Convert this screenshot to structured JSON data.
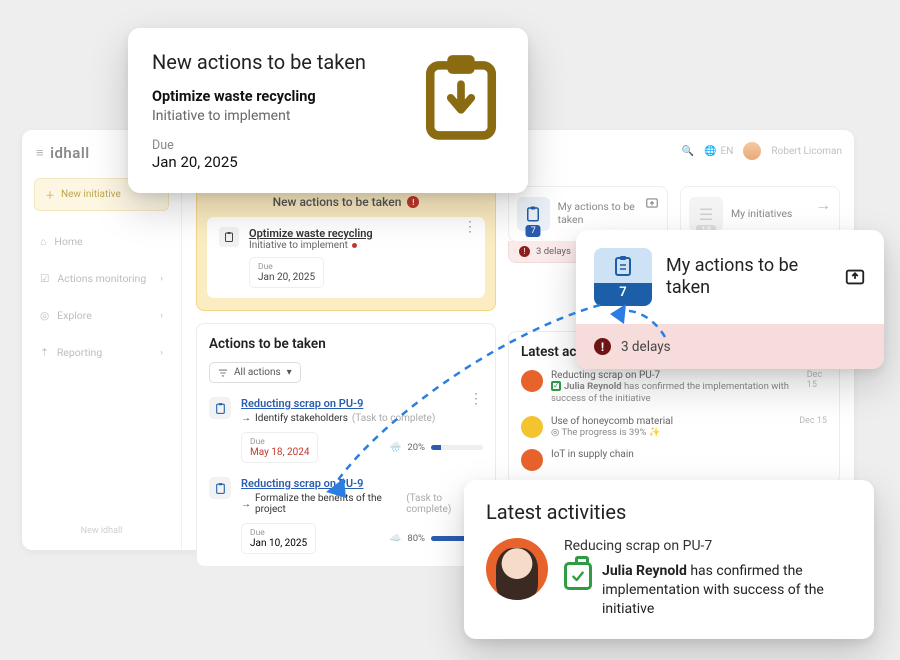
{
  "brand": "idhall",
  "topbar": {
    "lang": "EN",
    "user": "Robert Licoman"
  },
  "sidebar": {
    "new_initiative": "New initiative",
    "items": [
      {
        "label": "Home"
      },
      {
        "label": "Actions monitoring"
      },
      {
        "label": "Explore"
      },
      {
        "label": "Reporting"
      }
    ],
    "footer": "New idhall"
  },
  "highlight": {
    "title": "New actions to be taken",
    "item": {
      "title": "Optimize waste recycling",
      "subtitle": "Initiative to implement",
      "due_label": "Due",
      "due_value": "Jan 20, 2025"
    }
  },
  "actions_panel": {
    "title": "Actions to be taken",
    "filter": "All actions",
    "tasks": [
      {
        "title": "Reducting scrap on PU-9",
        "step": "Identify stakeholders",
        "hint": "(Task to complete)",
        "due_label": "Due",
        "due_value": "May 18, 2024",
        "due_color": "#c0392b",
        "progress": 20,
        "progress_label": "20%",
        "weather": "rain"
      },
      {
        "title": "Reducting scrap on PU-9",
        "step": "Formalize the benefits of the project",
        "hint": "(Task to complete)",
        "due_label": "Due",
        "due_value": "Jan 10, 2025",
        "due_color": "#444",
        "progress": 80,
        "progress_label": "80%",
        "weather": "cloud"
      }
    ]
  },
  "tiles": {
    "my_actions": {
      "label": "My actions to be taken",
      "count": "7"
    },
    "my_initiatives": {
      "label": "My initiatives",
      "count": "13"
    },
    "delays": "3 delays"
  },
  "latest_panel": {
    "title": "Latest activities",
    "rows": [
      {
        "title": "Reducting scrap on PU-7",
        "body_prefix": "Julia Reynold",
        "body_rest": " has confirmed the implementation with success of the initiative",
        "date": "Dec 15",
        "type": "check"
      },
      {
        "title": "Use of honeycomb material",
        "body_prefix": "",
        "body_rest": "The progress is 39% ✨",
        "date": "Dec 15",
        "type": "target"
      },
      {
        "title": "IoT in supply chain",
        "body_prefix": "",
        "body_rest": "",
        "date": "",
        "type": "dot"
      }
    ]
  },
  "popup_new": {
    "heading": "New actions to be taken",
    "title": "Optimize waste recycling",
    "subtitle": "Initiative to implement",
    "due_label": "Due",
    "due_value": "Jan 20, 2025"
  },
  "popup_my": {
    "heading": "My actions to be taken",
    "count": "7",
    "delays": "3 delays"
  },
  "popup_la": {
    "heading": "Latest activities",
    "title": "Reducing scrap on PU-7",
    "person": "Julia Reynold",
    "rest": " has confirmed the implementation with success of the initiative"
  }
}
